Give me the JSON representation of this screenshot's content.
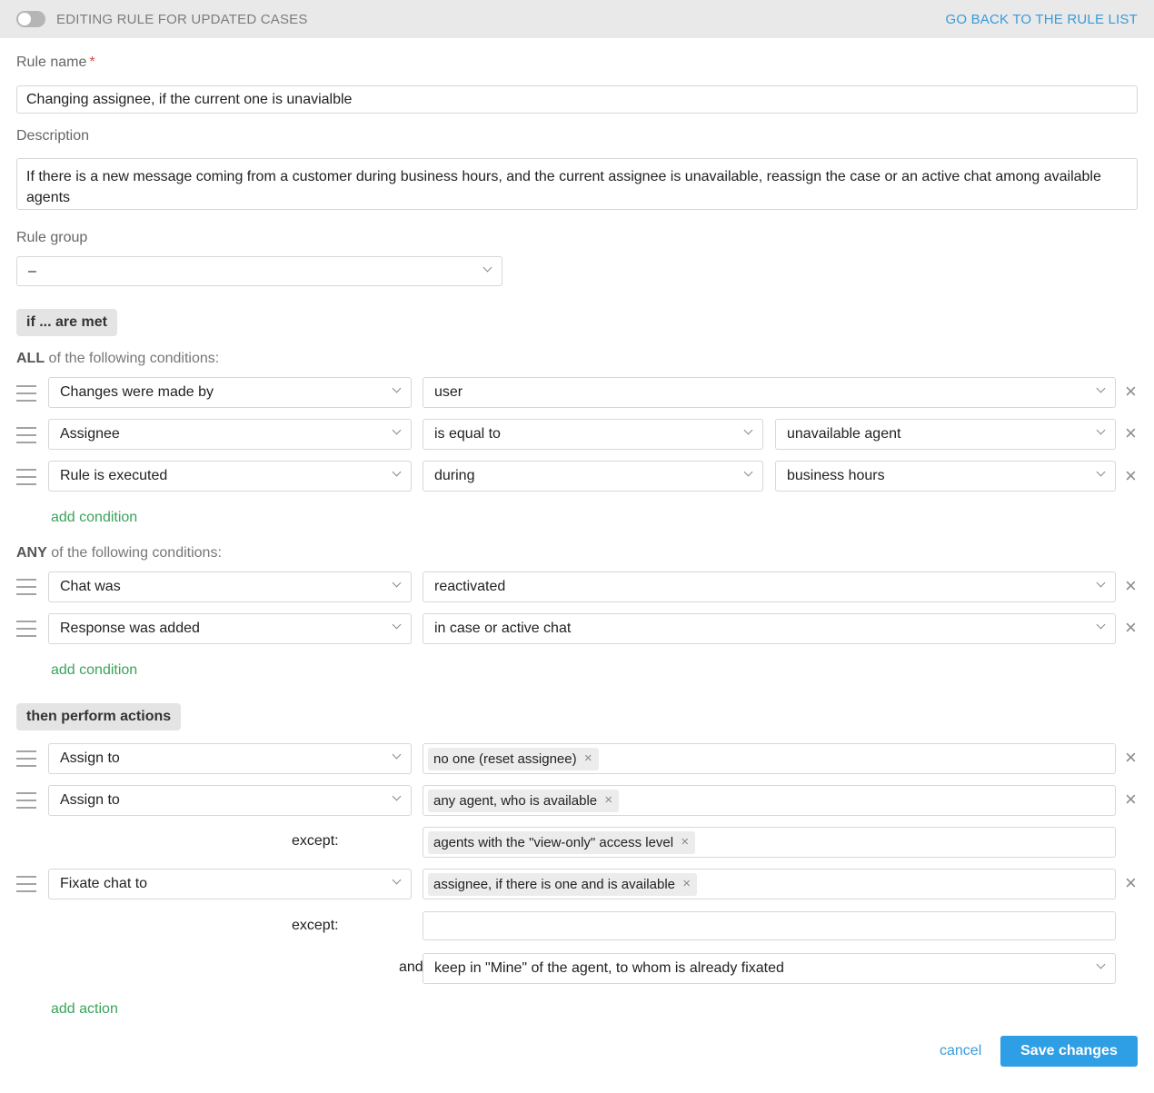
{
  "header": {
    "title": "EDITING RULE FOR UPDATED CASES",
    "back_link": "GO BACK TO THE RULE LIST"
  },
  "form": {
    "rule_name_label": "Rule name",
    "required_mark": "*",
    "rule_name_value": "Changing assignee, if the current one is unavialble",
    "description_label": "Description",
    "description_value": "If there is a new message coming from a customer during business hours, and the current assignee is unavailable, reassign the case or an active chat among available agents",
    "rule_group_label": "Rule group",
    "rule_group_value": "–"
  },
  "conditions": {
    "section_label": "if ... are met",
    "all_bold": "ALL",
    "all_rest": " of the following conditions:",
    "all_rows": [
      {
        "field": "Changes were made by",
        "op": "user"
      },
      {
        "field": "Assignee",
        "op": "is equal to",
        "value": "unavailable agent"
      },
      {
        "field": "Rule is executed",
        "op": "during",
        "value": "business hours"
      }
    ],
    "add_condition": "add condition",
    "any_bold": "ANY",
    "any_rest": " of the following conditions:",
    "any_rows": [
      {
        "field": "Chat was",
        "op": "reactivated"
      },
      {
        "field": "Response was added",
        "op": "in case or active chat"
      }
    ]
  },
  "actions": {
    "section_label": "then perform actions",
    "rows": [
      {
        "action": "Assign to",
        "tag": "no one (reset assignee)"
      },
      {
        "action": "Assign to",
        "tag": "any agent, who is available",
        "except_label": "except:",
        "except_tag": "agents with the \"view-only\" access level"
      },
      {
        "action": "Fixate chat to",
        "tag": "assignee, if there is one and is available",
        "except_label": "except:",
        "and_label": "and",
        "and_value": "keep in \"Mine\" of the agent, to whom is already fixated"
      }
    ],
    "add_action": "add action"
  },
  "footer": {
    "cancel": "cancel",
    "save": "Save changes"
  },
  "icons": {
    "remove": "×"
  },
  "colors": {
    "accent_blue": "#2e9ee5",
    "link_blue": "#3a9ad9",
    "link_green": "#3aa35a",
    "required_red": "#e04545"
  }
}
